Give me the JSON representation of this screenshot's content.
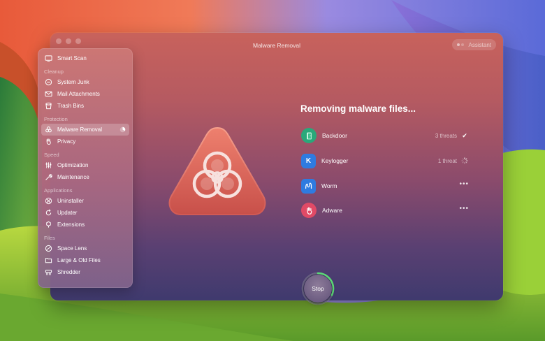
{
  "window": {
    "title": "Malware Removal",
    "assistant_label": "Assistant"
  },
  "sidebar": {
    "items": [
      {
        "label": "Smart Scan",
        "icon": "monitor-icon"
      },
      {
        "section": "Cleanup"
      },
      {
        "label": "System Junk",
        "icon": "junk-icon"
      },
      {
        "label": "Mail Attachments",
        "icon": "mail-icon"
      },
      {
        "label": "Trash Bins",
        "icon": "trash-icon"
      },
      {
        "section": "Protection"
      },
      {
        "label": "Malware Removal",
        "icon": "biohazard-icon",
        "active": true
      },
      {
        "label": "Privacy",
        "icon": "hand-icon"
      },
      {
        "section": "Speed"
      },
      {
        "label": "Optimization",
        "icon": "sliders-icon"
      },
      {
        "label": "Maintenance",
        "icon": "wrench-icon"
      },
      {
        "section": "Applications"
      },
      {
        "label": "Uninstaller",
        "icon": "uninstaller-icon"
      },
      {
        "label": "Updater",
        "icon": "updater-icon"
      },
      {
        "label": "Extensions",
        "icon": "extensions-icon"
      },
      {
        "section": "Files"
      },
      {
        "label": "Space Lens",
        "icon": "space-lens-icon"
      },
      {
        "label": "Large & Old Files",
        "icon": "folder-icon"
      },
      {
        "label": "Shredder",
        "icon": "shredder-icon"
      }
    ]
  },
  "main": {
    "heading": "Removing malware files...",
    "threats": [
      {
        "name": "Backdoor",
        "count": "3 threats",
        "status": "done",
        "icon": "door-icon",
        "color": "#2aa87a"
      },
      {
        "name": "Keylogger",
        "count": "1 threat",
        "status": "in-progress",
        "icon": "keyboard-k-icon",
        "color": "#2f7be0",
        "icon_text": "K"
      },
      {
        "name": "Worm",
        "count": "",
        "status": "pending",
        "icon": "worm-icon",
        "color": "#2f7be0"
      },
      {
        "name": "Adware",
        "count": "",
        "status": "pending",
        "icon": "adware-hand-icon",
        "color": "#e04a66"
      }
    ],
    "stop_label": "Stop",
    "stop_progress": 0.32
  },
  "colors": {
    "accent_progress": "#5ee07a",
    "hero_top": "#e8786a",
    "hero_bottom": "#c24a45"
  }
}
